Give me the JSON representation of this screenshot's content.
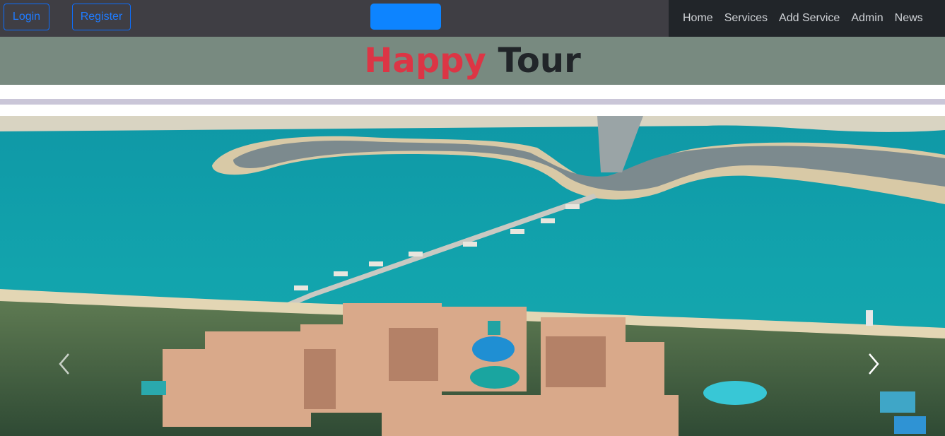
{
  "auth": {
    "login_label": "Login",
    "register_label": "Register"
  },
  "nav": {
    "items": [
      {
        "label": "Home"
      },
      {
        "label": "Services"
      },
      {
        "label": "Add Service"
      },
      {
        "label": "Admin"
      },
      {
        "label": "News"
      }
    ]
  },
  "header": {
    "title_part1": "Happy",
    "title_part2": "Tour"
  },
  "colors": {
    "topbar": "#3f3e44",
    "navbar": "#212529",
    "banner": "#788a80",
    "title_accent": "#dc3545",
    "button_primary": "#0d84ff",
    "divider": "#cac6d8"
  },
  "carousel": {
    "prev_icon": "chevron-left-icon",
    "next_icon": "chevron-right-icon"
  }
}
